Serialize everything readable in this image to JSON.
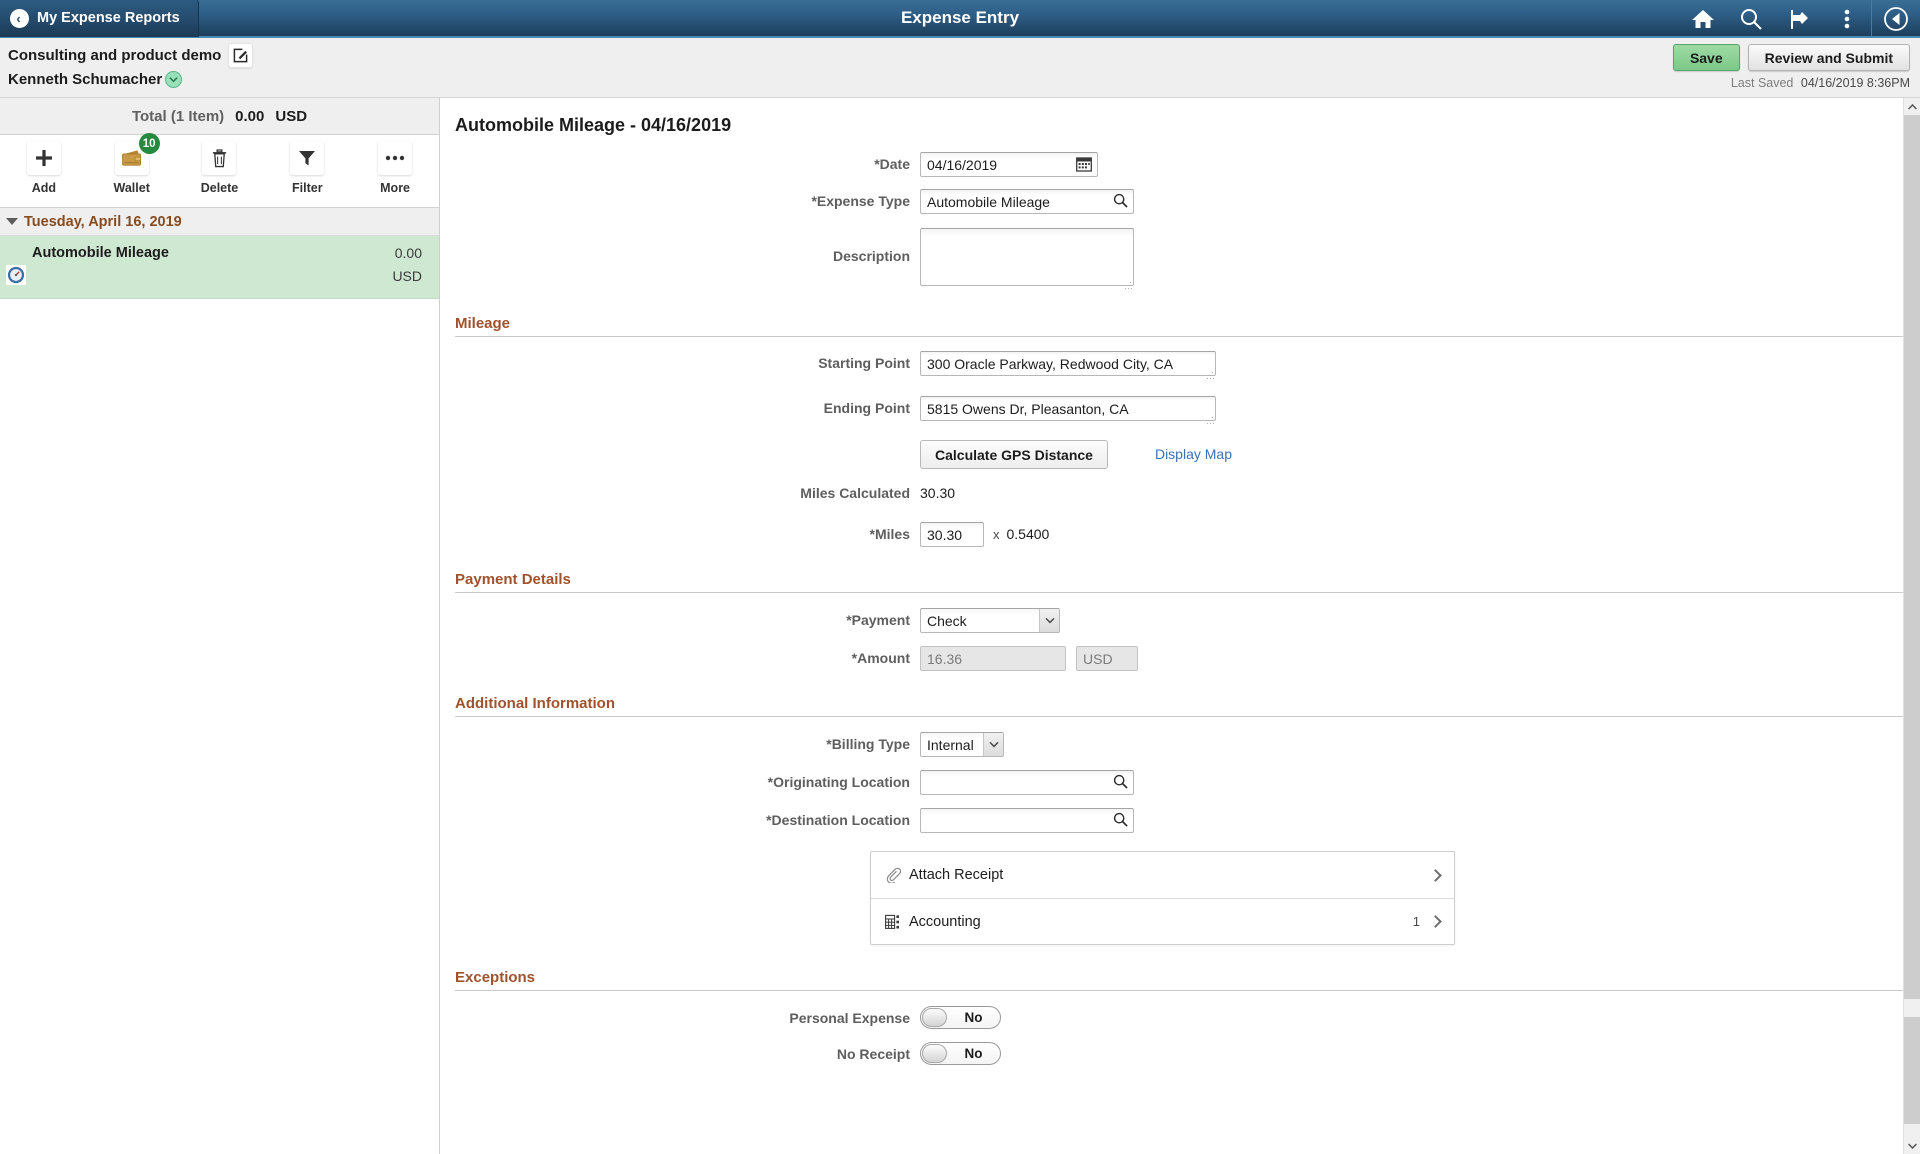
{
  "header": {
    "back_label": "My Expense Reports",
    "title": "Expense Entry",
    "icons": [
      "home-icon",
      "search-icon",
      "notifications-flag-icon",
      "actions-kebab-icon",
      "navbar-compass-icon"
    ]
  },
  "subheader": {
    "report_name": "Consulting and product demo",
    "employee_name": "Kenneth Schumacher",
    "save_label": "Save",
    "review_submit_label": "Review and Submit",
    "last_saved_label": "Last Saved",
    "last_saved_value": "04/16/2019  8:36PM"
  },
  "sidebar": {
    "total_label": "Total (1 Item)",
    "total_amount": "0.00",
    "total_currency": "USD",
    "tools": [
      {
        "label": "Add",
        "icon": "plus-icon",
        "badge": ""
      },
      {
        "label": "Wallet",
        "icon": "wallet-icon",
        "badge": "10"
      },
      {
        "label": "Delete",
        "icon": "trash-icon",
        "badge": ""
      },
      {
        "label": "Filter",
        "icon": "funnel-icon",
        "badge": ""
      },
      {
        "label": "More",
        "icon": "ellipsis-icon",
        "badge": ""
      }
    ],
    "date_group": "Tuesday, April 16, 2019",
    "expense_rows": [
      {
        "name": "Automobile Mileage",
        "amount": "0.00",
        "currency": "USD",
        "icon": "mileage-gauge-icon"
      }
    ]
  },
  "form": {
    "title": "Automobile Mileage - 04/16/2019",
    "date_label": "*Date",
    "date_value": "04/16/2019",
    "expense_type_label": "*Expense Type",
    "expense_type_value": "Automobile Mileage",
    "description_label": "Description",
    "description_value": "",
    "mileage": {
      "section_title": "Mileage",
      "starting_point_label": "Starting Point",
      "starting_point_value": "300 Oracle Parkway, Redwood City, CA",
      "ending_point_label": "Ending Point",
      "ending_point_value": "5815 Owens Dr, Pleasanton, CA",
      "gps_button_label": "Calculate GPS Distance",
      "display_map_label": "Display Map",
      "miles_calculated_label": "Miles Calculated",
      "miles_calculated_value": "30.30",
      "miles_label": "*Miles",
      "miles_value": "30.30",
      "multiply_symbol": "x",
      "rate_value": "0.5400"
    },
    "payment": {
      "section_title": "Payment Details",
      "payment_label": "*Payment",
      "payment_value": "Check",
      "payment_options": [
        "Check"
      ],
      "amount_label": "*Amount",
      "amount_value": "16.36",
      "currency_value": "USD"
    },
    "additional": {
      "section_title": "Additional Information",
      "billing_type_label": "*Billing Type",
      "billing_type_value": "Internal",
      "billing_type_options": [
        "Internal"
      ],
      "originating_location_label": "*Originating Location",
      "originating_location_value": "",
      "destination_location_label": "*Destination Location",
      "destination_location_value": ""
    },
    "panels": [
      {
        "label": "Attach Receipt",
        "icon": "paperclip-icon",
        "count": ""
      },
      {
        "label": "Accounting",
        "icon": "accounting-grid-icon",
        "count": "1"
      }
    ],
    "exceptions": {
      "section_title": "Exceptions",
      "personal_expense_label": "Personal Expense",
      "personal_expense_value": "No",
      "no_receipt_label": "No Receipt",
      "no_receipt_value": "No"
    }
  },
  "colors": {
    "header_blue": "#2f6089",
    "section_heading": "#a0522d",
    "selected_row_green": "#cfe8d2",
    "save_green": "#7cc888",
    "link_blue": "#3b72b0",
    "badge_green": "#27893f"
  }
}
